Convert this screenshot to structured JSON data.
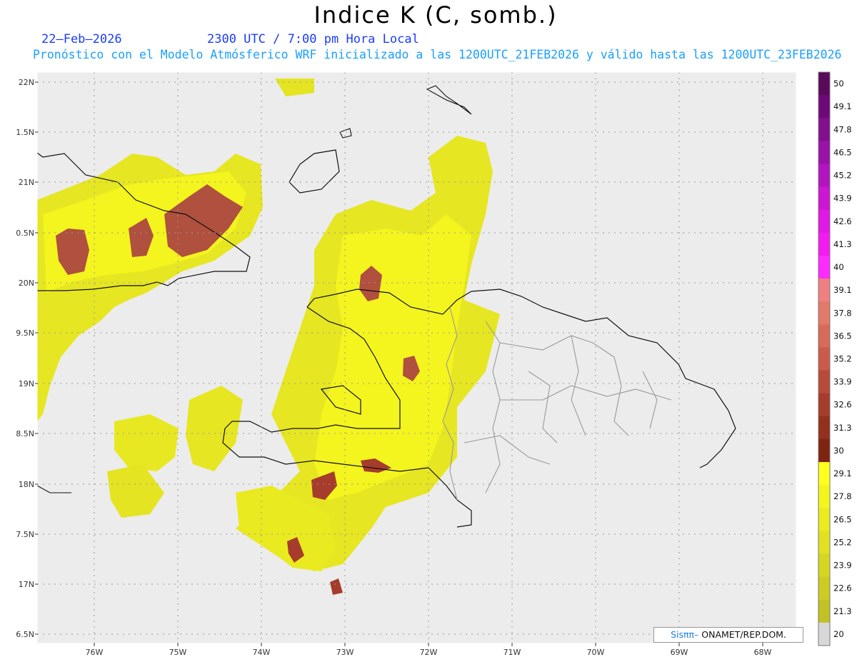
{
  "header": {
    "title": "Indice K (C, somb.)",
    "date": "22–Feb–2026",
    "time": "2300 UTC / 7:00 pm Hora Local",
    "line2": "Pronóstico con el Modelo Atmósferico WRF inicializado a las 1200UTC_21FEB2026 y válido hasta las  1200UTC_23FEB2026"
  },
  "credit": {
    "logo": "Sisππ–",
    "org": " ONAMET/REP.DOM."
  },
  "map": {
    "lon_ticks": [
      "76W",
      "75W",
      "74W",
      "73W",
      "72W",
      "71W",
      "70W",
      "69W",
      "68W"
    ],
    "lat_ticks": [
      "22N",
      "1.5N",
      "21N",
      "0.5N",
      "20N",
      "9.5N",
      "19N",
      "8.5N",
      "18N",
      "7.5N",
      "17N",
      "6.5N"
    ],
    "background_color": "#ececec",
    "shaded_regions": [
      {
        "name": "cuba-east-band",
        "level": "26"
      },
      {
        "name": "hispaniola-west",
        "level": "28"
      },
      {
        "name": "southern-peninsula",
        "level": "27"
      }
    ],
    "max_cells": [
      {
        "name": "cuba-cell-west",
        "value": "33"
      },
      {
        "name": "cuba-cell-east",
        "value": "33"
      },
      {
        "name": "tortuga-cell",
        "value": "33"
      },
      {
        "name": "central-haiti-cell",
        "value": "33"
      },
      {
        "name": "south-coast-cell",
        "value": "32"
      },
      {
        "name": "offshore-cell",
        "value": "32"
      }
    ]
  },
  "colorbar": {
    "labels": [
      "50",
      "49.1",
      "47.8",
      "46.5",
      "45.2",
      "43.9",
      "42.6",
      "41.3",
      "40",
      "39.1",
      "37.8",
      "36.5",
      "35.2",
      "33.9",
      "32.6",
      "31.3",
      "30",
      "29.1",
      "27.8",
      "26.5",
      "25.2",
      "23.9",
      "22.6",
      "21.3",
      "20"
    ],
    "colors": [
      "#5a0a5a",
      "#6e0a78",
      "#82108c",
      "#9a12a8",
      "#b414c0",
      "#cc16d4",
      "#e018e6",
      "#f21cf0",
      "#ff2aff",
      "#f08080",
      "#e27a6a",
      "#d86a5a",
      "#cc5a4a",
      "#b84a3a",
      "#a63c2c",
      "#94301e",
      "#7e2410",
      "#ffff1e",
      "#f5f51e",
      "#ebeb20",
      "#e1e120",
      "#d6d622",
      "#cccc22",
      "#c2c224",
      "#d8d8d8"
    ]
  }
}
